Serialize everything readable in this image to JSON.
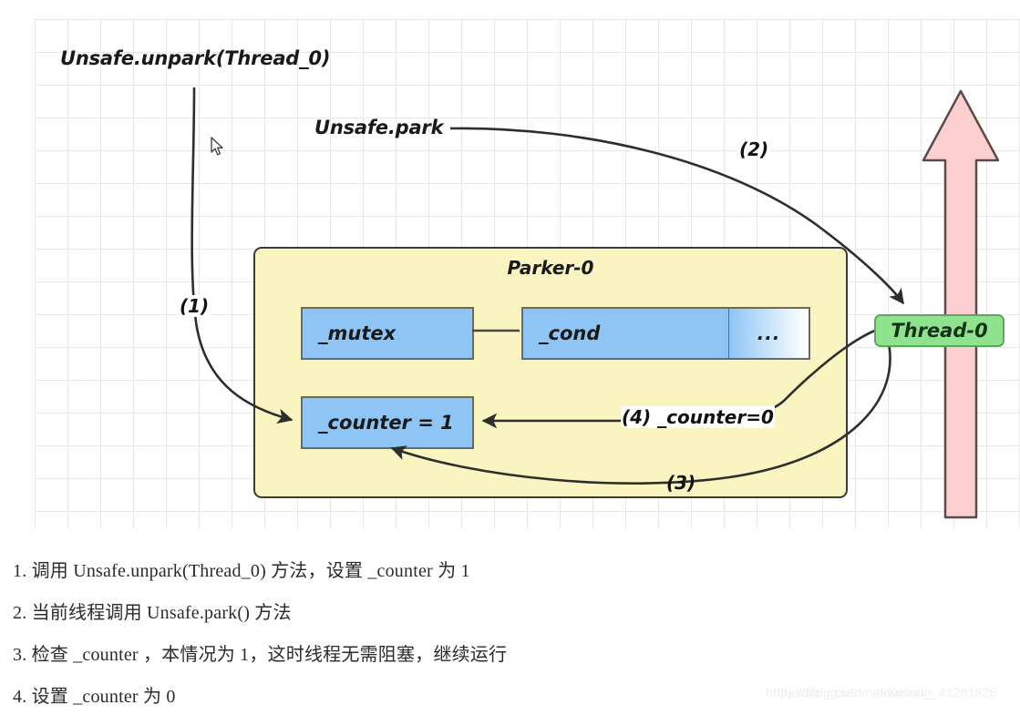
{
  "diagram": {
    "labels": {
      "unpark": "Unsafe.unpark(Thread_0)",
      "park": "Unsafe.park"
    },
    "steps_on_diagram": {
      "one": "(1)",
      "two": "(2)",
      "three": "(3)",
      "four": "(4) _counter=0"
    },
    "parker": {
      "title": "Parker-0",
      "fields": {
        "mutex": "_mutex",
        "cond": "_cond",
        "more": "...",
        "counter": "_counter = 1"
      }
    },
    "thread": {
      "badge": "Thread-0"
    },
    "colors": {
      "parker_fill": "#faf4c0",
      "parker_border": "#3b3b38",
      "field_fill": "#8ec5f5",
      "field_border": "#6a6a60",
      "thread_badge_fill": "#8fe38f",
      "thread_badge_border": "#5aa95a",
      "lifeline_fill": "#fbcfcf",
      "lifeline_border": "#5c4a4a",
      "arrow_stroke": "#2e2e2e",
      "grid_line": "#e8e8e8"
    }
  },
  "explanation": {
    "items": [
      "1. 调用 Unsafe.unpark(Thread_0) 方法，设置 _counter 为 1",
      "2. 当前线程调用 Unsafe.park() 方法",
      "3. 检查 _counter ，本情况为 1，这时线程无需阻塞，继续运行",
      "4. 设置 _counter 为 0"
    ]
  },
  "watermark": {
    "line1": "https://blog.csdn.net/weixin_",
    "line2": "https://blog.csdn.net/weixin_41281928"
  }
}
